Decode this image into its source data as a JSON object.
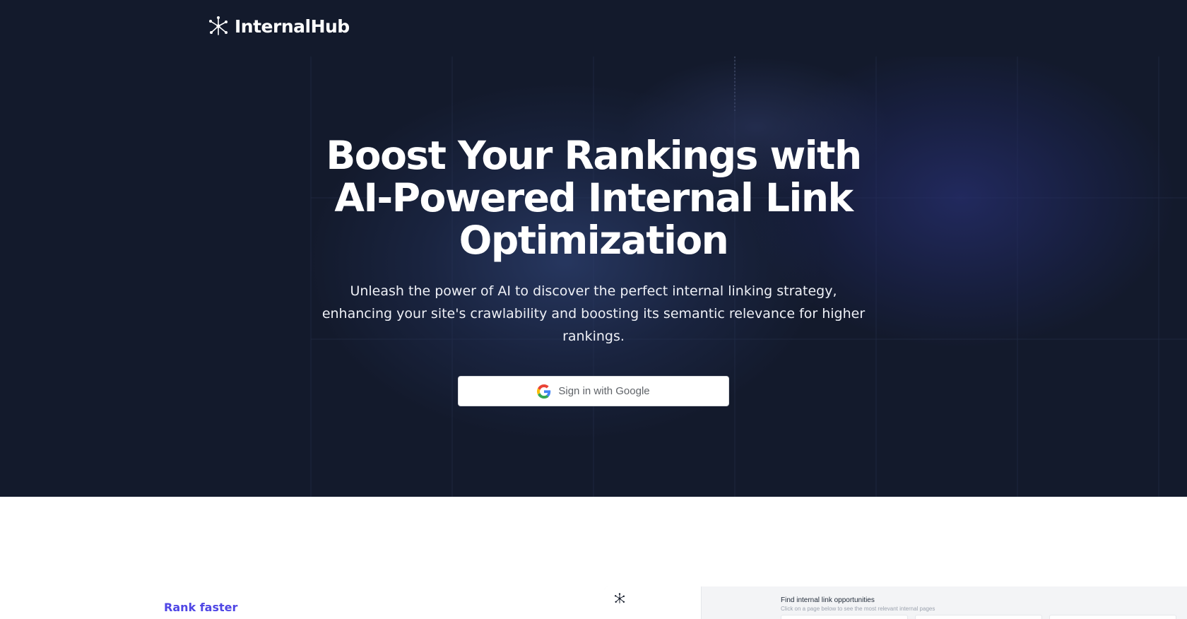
{
  "nav": {
    "brand": "InternalHub"
  },
  "hero": {
    "title": "Boost Your Rankings with AI-Powered Internal Link Optimization",
    "subtitle": "Unleash the power of AI to discover the perfect internal linking strategy, enhancing your site's crawlability and boosting its semantic relevance for higher rankings.",
    "cta_label": "Sign in with Google"
  },
  "features": {
    "eyebrow": "Rank faster",
    "preview": {
      "title": "Find internal link opportunities",
      "description": "Click on a page below to see the most relevant internal pages"
    }
  },
  "icons": {
    "brand": "network-nodes-icon",
    "cta": "google-g-icon"
  },
  "colors": {
    "hero_background": "#131a2c",
    "accent": "#4f46e5",
    "button_background": "#ffffff",
    "button_text": "#5f6368"
  }
}
